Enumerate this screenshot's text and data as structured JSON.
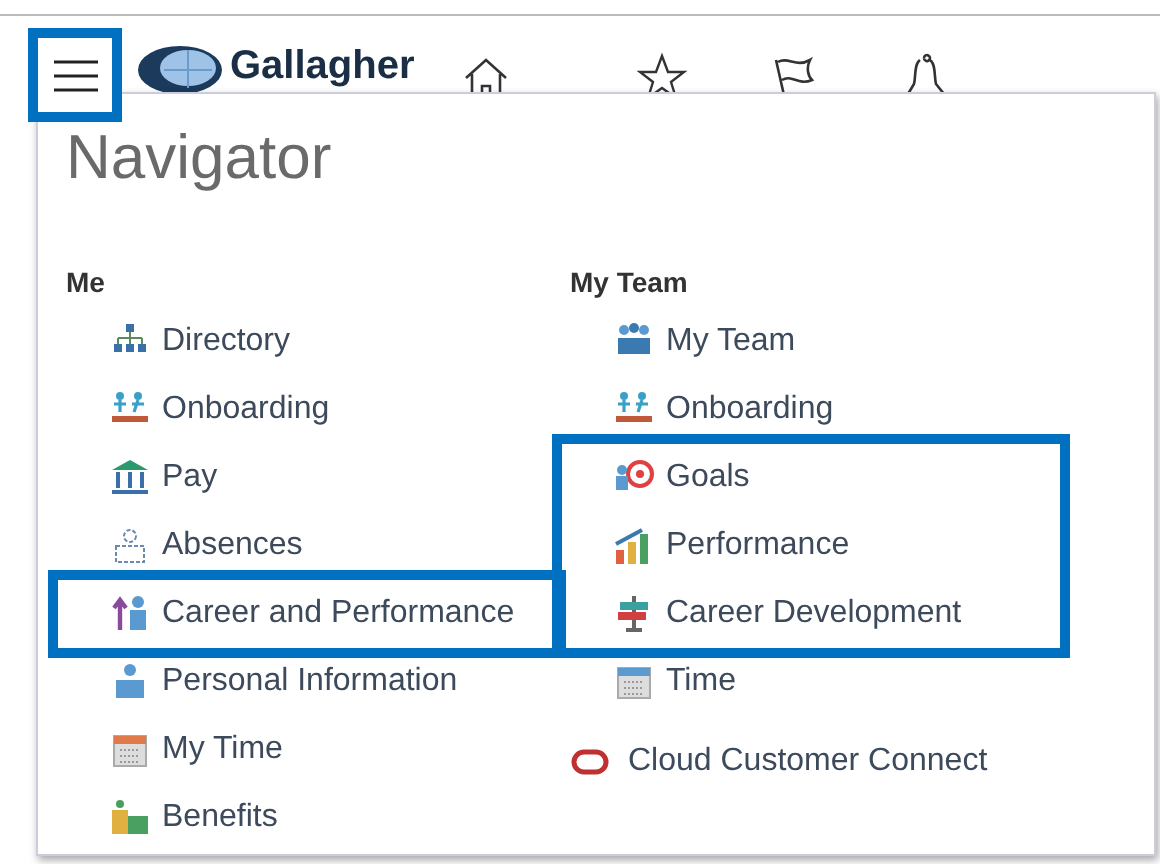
{
  "header": {
    "menu_button": {
      "highlighted": true
    },
    "logo_text": "Gallagher"
  },
  "navigator": {
    "title": "Navigator",
    "columns": [
      {
        "heading": "Me",
        "items": [
          {
            "label": "Directory",
            "highlighted": false
          },
          {
            "label": "Onboarding",
            "highlighted": false
          },
          {
            "label": "Pay",
            "highlighted": false
          },
          {
            "label": "Absences",
            "highlighted": false
          },
          {
            "label": "Career and Performance",
            "highlighted": true
          },
          {
            "label": "Personal Information",
            "highlighted": false
          },
          {
            "label": "My Time",
            "highlighted": false
          },
          {
            "label": "Benefits",
            "highlighted": false
          }
        ]
      },
      {
        "heading": "My Team",
        "items": [
          {
            "label": "My Team",
            "highlighted": false
          },
          {
            "label": "Onboarding",
            "highlighted": false
          },
          {
            "label": "Goals",
            "highlighted": true
          },
          {
            "label": "Performance",
            "highlighted": true
          },
          {
            "label": "Career Development",
            "highlighted": true
          },
          {
            "label": "Time",
            "highlighted": false
          }
        ],
        "extra": {
          "label": "Cloud Customer Connect"
        }
      }
    ]
  }
}
